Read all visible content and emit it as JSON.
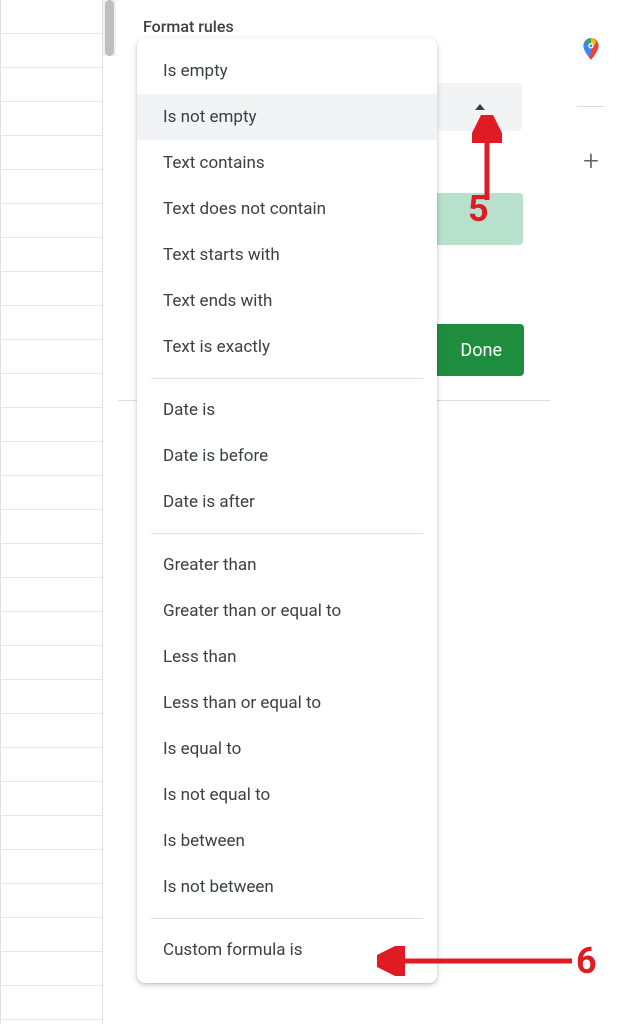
{
  "section": {
    "label": "Format rules"
  },
  "dropdown": {
    "items": [
      {
        "label": "Is empty",
        "hovered": false
      },
      {
        "label": "Is not empty",
        "hovered": true
      },
      {
        "label": "Text contains",
        "hovered": false
      },
      {
        "label": "Text does not contain",
        "hovered": false
      },
      {
        "label": "Text starts with",
        "hovered": false
      },
      {
        "label": "Text ends with",
        "hovered": false
      },
      {
        "label": "Text is exactly",
        "hovered": false
      }
    ],
    "items2": [
      {
        "label": "Date is"
      },
      {
        "label": "Date is before"
      },
      {
        "label": "Date is after"
      }
    ],
    "items3": [
      {
        "label": "Greater than"
      },
      {
        "label": "Greater than or equal to"
      },
      {
        "label": "Less than"
      },
      {
        "label": "Less than or equal to"
      },
      {
        "label": "Is equal to"
      },
      {
        "label": "Is not equal to"
      },
      {
        "label": "Is between"
      },
      {
        "label": "Is not between"
      }
    ],
    "items4": [
      {
        "label": "Custom formula is"
      }
    ]
  },
  "buttons": {
    "done": "Done"
  },
  "annotations": {
    "label5": "5",
    "label6": "6"
  }
}
